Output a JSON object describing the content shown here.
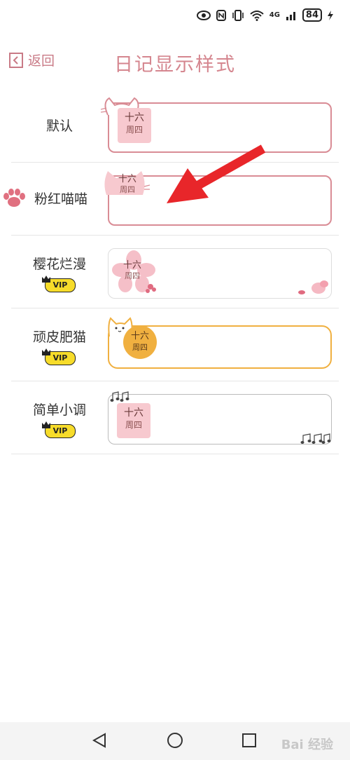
{
  "status_bar": {
    "battery": "84",
    "network": "4G"
  },
  "header": {
    "back_label": "返回",
    "title": "日记显示样式"
  },
  "styles": [
    {
      "name": "默认",
      "vip": "",
      "date_day": "十六",
      "date_week": "周四"
    },
    {
      "name": "粉红喵喵",
      "vip": "",
      "date_day": "十六",
      "date_week": "周四"
    },
    {
      "name": "樱花烂漫",
      "vip": "VIP",
      "date_day": "十六",
      "date_week": "周四"
    },
    {
      "name": "顽皮肥猫",
      "vip": "VIP",
      "date_day": "十六",
      "date_week": "周四"
    },
    {
      "name": "简单小调",
      "vip": "VIP",
      "date_day": "十六",
      "date_week": "周四"
    }
  ],
  "colors": {
    "accent": "#d5868f",
    "pink_border": "#d98c95",
    "orange": "#f0b040",
    "vip_yellow": "#f7dc2a",
    "arrow_red": "#e8262a"
  },
  "navbar": {
    "icons": [
      "back-triangle-icon",
      "home-circle-icon",
      "recents-square-icon"
    ]
  },
  "watermark": "Bai 经验"
}
